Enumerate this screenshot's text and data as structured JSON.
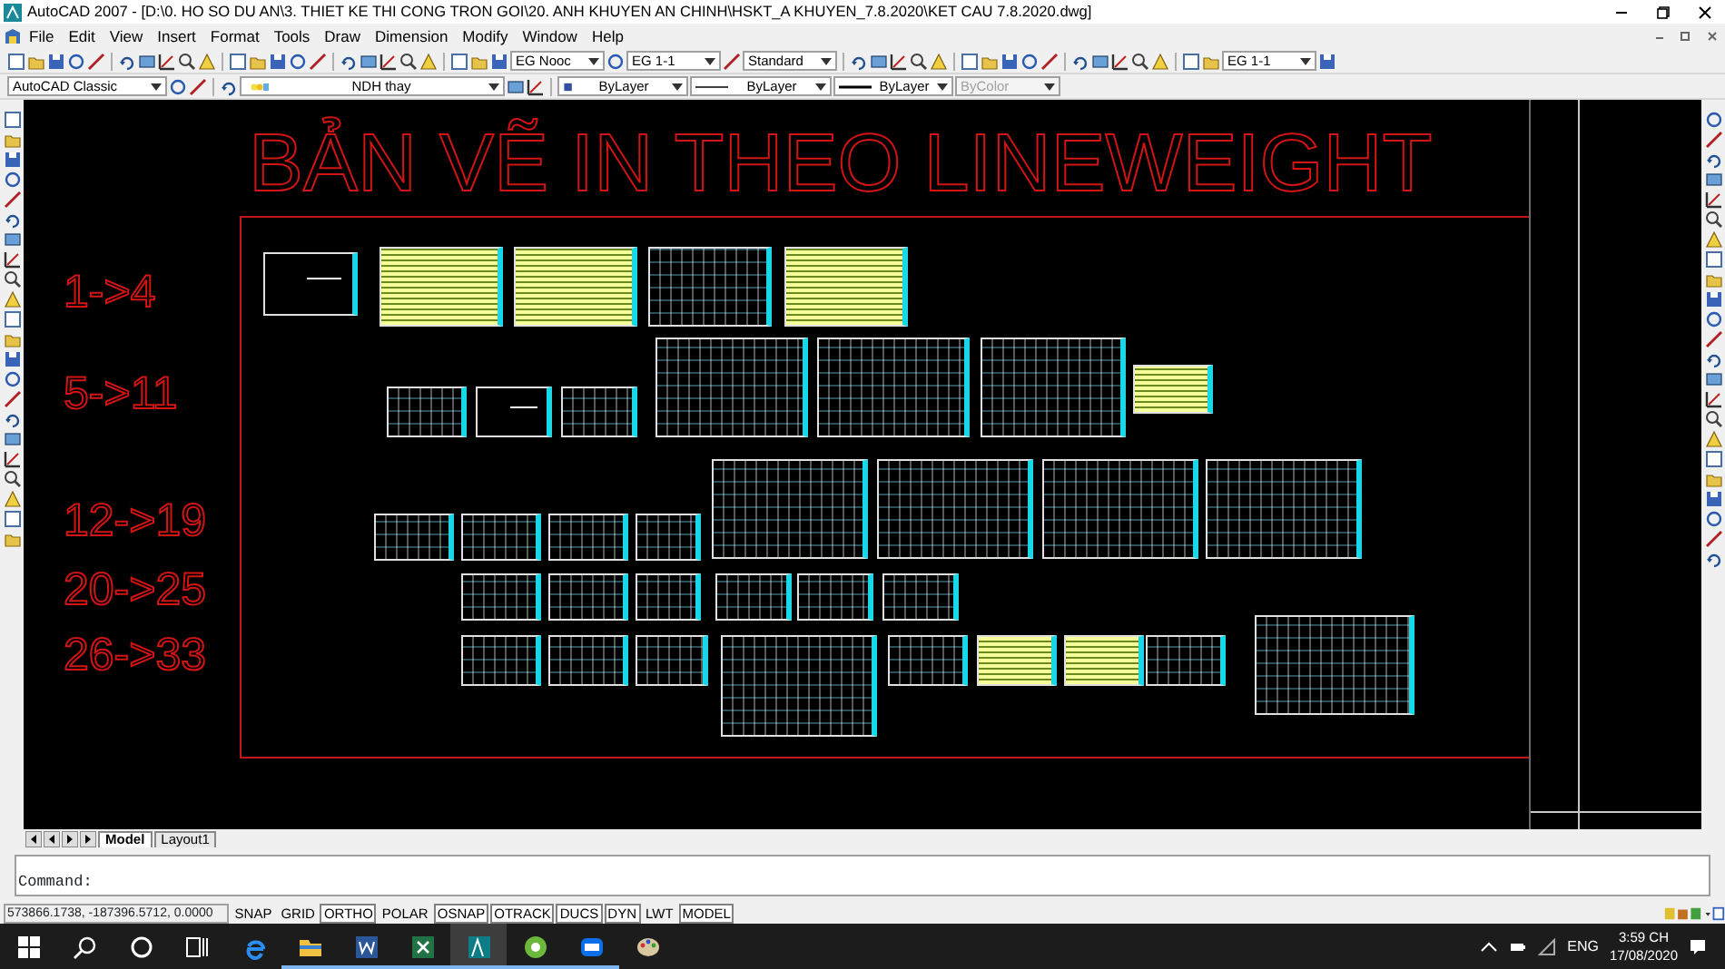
{
  "window": {
    "title": "AutoCAD 2007 - [D:\\0. HO SO DU AN\\3. THIET KE THI CONG TRON GOI\\20. ANH KHUYEN AN CHINH\\HSKT_A KHUYEN_7.8.2020\\KET CAU 7.8.2020.dwg]"
  },
  "menu": [
    "File",
    "Edit",
    "View",
    "Insert",
    "Format",
    "Tools",
    "Draw",
    "Dimension",
    "Modify",
    "Window",
    "Help"
  ],
  "toolbar_1": {
    "dropdowns": [
      {
        "value": "EG Nooc",
        "disabled": false
      },
      {
        "value": "EG 1-1",
        "disabled": false
      },
      {
        "value": "Standard",
        "disabled": false
      },
      {
        "value": "EG 1-1",
        "disabled": false
      }
    ]
  },
  "toolbar_2": {
    "dropdowns": [
      {
        "value": "AutoCAD Classic",
        "disabled": false
      },
      {
        "value": "NDH thay",
        "disabled": false
      },
      {
        "value": "ByLayer",
        "disabled": false
      },
      {
        "value": "ByLayer",
        "disabled": false
      },
      {
        "value": "ByLayer",
        "disabled": false
      },
      {
        "value": "ByColor",
        "disabled": true
      }
    ]
  },
  "drawing": {
    "heading": "BẢN VẼ IN THEO LINEWEIGHT",
    "labels": [
      "1->4",
      "5->11",
      "12->19",
      "20->25",
      "26->33"
    ]
  },
  "layout_tabs": [
    {
      "label": "Model",
      "selected": true
    },
    {
      "label": "Layout1",
      "selected": false
    }
  ],
  "command_line": {
    "prompt": "Command:"
  },
  "status_bar": {
    "coordinates": "573866.1738, -187396.5712, 0.0000",
    "toggles": [
      {
        "label": "SNAP",
        "on": false
      },
      {
        "label": "GRID",
        "on": false
      },
      {
        "label": "ORTHO",
        "on": true
      },
      {
        "label": "POLAR",
        "on": false
      },
      {
        "label": "OSNAP",
        "on": true
      },
      {
        "label": "OTRACK",
        "on": true
      },
      {
        "label": "DUCS",
        "on": true
      },
      {
        "label": "DYN",
        "on": true
      },
      {
        "label": "LWT",
        "on": false
      },
      {
        "label": "MODEL",
        "on": true
      }
    ]
  },
  "taskbar": {
    "apps": [
      {
        "kind": "start",
        "active": false,
        "selected": false
      },
      {
        "kind": "search",
        "active": false,
        "selected": false
      },
      {
        "kind": "cortana",
        "active": false,
        "selected": false
      },
      {
        "kind": "taskview",
        "active": false,
        "selected": false
      },
      {
        "kind": "edge",
        "active": false,
        "selected": false
      },
      {
        "kind": "explorer",
        "active": true,
        "selected": false
      },
      {
        "kind": "word",
        "active": true,
        "selected": false
      },
      {
        "kind": "excel",
        "active": true,
        "selected": false
      },
      {
        "kind": "autocad",
        "active": true,
        "selected": true
      },
      {
        "kind": "greenapp",
        "active": true,
        "selected": false
      },
      {
        "kind": "zalo",
        "active": true,
        "selected": false
      },
      {
        "kind": "paint",
        "active": false,
        "selected": false
      }
    ],
    "language": "ENG",
    "time": "3:59 CH",
    "date": "17/08/2020"
  }
}
